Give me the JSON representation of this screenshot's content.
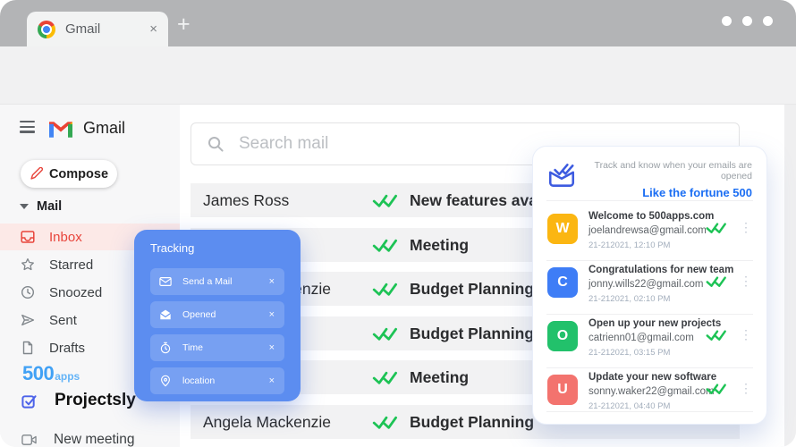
{
  "browser": {
    "tab_title": "Gmail",
    "tab_close": "×",
    "new_tab": "+"
  },
  "gmail": {
    "brand": "Gmail",
    "compose_label": "Compose",
    "mail_section": "Mail",
    "nav": [
      {
        "label": "Inbox",
        "active": true
      },
      {
        "label": "Starred",
        "active": false
      },
      {
        "label": "Snoozed",
        "active": false
      },
      {
        "label": "Sent",
        "active": false
      },
      {
        "label": "Drafts",
        "active": false
      }
    ],
    "brand_500": {
      "number": "500",
      "suffix": "apps"
    },
    "projectsly_label": "Projectsly",
    "new_meeting_label": "New meeting",
    "search_placeholder": "Search mail",
    "emails": [
      {
        "name": "James Ross",
        "subject": "New features available"
      },
      {
        "name": "",
        "subject": "Meeting"
      },
      {
        "name": "Angela Mackenzie",
        "subject": "Budget Planning"
      },
      {
        "name": "",
        "subject": "Budget Planning"
      },
      {
        "name": "",
        "subject": "Meeting"
      },
      {
        "name": "Angela Mackenzie",
        "subject": "Budget Planning"
      }
    ]
  },
  "tracking_popup": {
    "title": "Tracking",
    "close": "×",
    "items": [
      {
        "label": "Send a Mail",
        "icon": "mail-icon"
      },
      {
        "label": "Opened",
        "icon": "mail-open-icon"
      },
      {
        "label": "Time",
        "icon": "timer-icon"
      },
      {
        "label": "location",
        "icon": "location-pin-icon"
      }
    ]
  },
  "panel": {
    "header_line1": "Track and know when your emails are opened",
    "header_line2": "Like the fortune 500",
    "items": [
      {
        "initial": "W",
        "avatar_color": "#fbb612",
        "title": "Welcome to 500apps.com",
        "email": "joelandrewsa@gmail.com",
        "time": "21-212021, 12:10 PM",
        "dots": "⋮"
      },
      {
        "initial": "C",
        "avatar_color": "#3e7df6",
        "title": "Congratulations for new team",
        "email": "jonny.wills22@gmail.com",
        "time": "21-212021, 02:10 PM",
        "dots": "⋮"
      },
      {
        "initial": "O",
        "avatar_color": "#22c16b",
        "title": "Open up your new projects",
        "email": "catrienn01@gmail.com",
        "time": "21-212021, 03:15 PM",
        "dots": "⋮"
      },
      {
        "initial": "U",
        "avatar_color": "#f3736e",
        "title": "Update your new software",
        "email": "sonny.waker22@gmail.com",
        "time": "21-212021, 04:40 PM",
        "dots": "⋮"
      }
    ]
  },
  "colors": {
    "accent_blue": "#5c8df0",
    "link_blue": "#1b6ef3",
    "check_green": "#1dc355",
    "inbox_red": "#e8453c",
    "titlebar_gray": "#b3b4b6"
  }
}
